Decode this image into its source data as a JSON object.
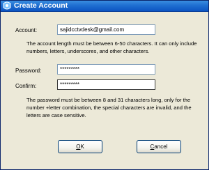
{
  "window": {
    "title": "Create Account",
    "title_icon": "app-icon"
  },
  "account": {
    "label": "Account:",
    "value": "sajidcctvdesk@gmail.com",
    "help": "The account length must be between 6-50 characters. It can only include numbers, letters, underscores, and other characters."
  },
  "password": {
    "label": "Password:",
    "value": "*********"
  },
  "confirm": {
    "label": "Confirm:",
    "value": "*********",
    "help": "The password must be between 8 and 31 characters long, only for the number +letter combination, the special characters are invalid, and the letters are case sensitive."
  },
  "buttons": {
    "ok_underlined": "O",
    "ok_rest": "K",
    "cancel_underlined": "C",
    "cancel_rest": "ancel"
  },
  "colors": {
    "titlebar": "#0c54c2",
    "dialog_bg": "#ece9d8",
    "field_border": "#7f9db9",
    "button_border": "#003c74"
  }
}
